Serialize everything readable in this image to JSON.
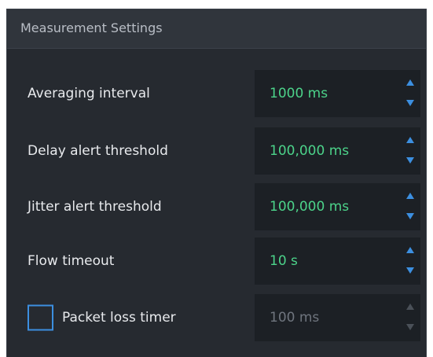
{
  "panel": {
    "title": "Measurement Settings"
  },
  "fields": [
    {
      "label": "Averaging interval",
      "value": "1000 ms"
    },
    {
      "label": "Delay alert threshold",
      "value": "100,000 ms"
    },
    {
      "label": "Jitter alert threshold",
      "value": "100,000 ms"
    },
    {
      "label": "Flow timeout",
      "value": "10 s"
    }
  ],
  "packet_loss": {
    "label": "Packet loss timer",
    "value": "100 ms",
    "checked": false,
    "enabled": false
  },
  "colors": {
    "panel_bg": "#262a30",
    "header_bg": "#30353c",
    "spin_bg": "#1c2025",
    "value_text": "#4cd38a",
    "accent": "#3c8fe0",
    "disabled_text": "#6f757e"
  },
  "icons": {
    "increment": "triangle-up-icon",
    "decrement": "triangle-down-icon"
  }
}
